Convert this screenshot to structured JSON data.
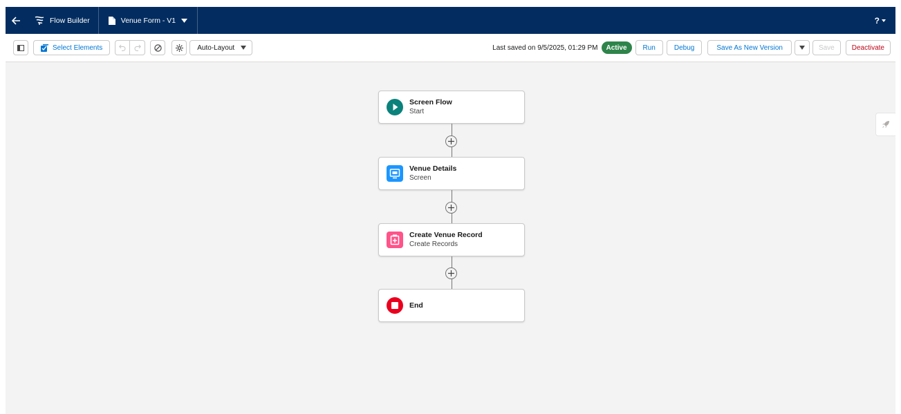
{
  "topbar": {
    "app_label": "Flow Builder",
    "flow_label": "Venue Form - V1",
    "help_label": "?"
  },
  "toolbar": {
    "select_elements_label": "Select Elements",
    "layout_label": "Auto-Layout",
    "last_saved": "Last saved on 9/5/2025, 01:29 PM",
    "status_badge": "Active",
    "run_label": "Run",
    "debug_label": "Debug",
    "save_as_new_version_label": "Save As New Version",
    "save_label": "Save",
    "deactivate_label": "Deactivate"
  },
  "flow": {
    "nodes": [
      {
        "title": "Screen Flow",
        "subtitle": "Start",
        "icon": "play-icon",
        "color": "#0b827c"
      },
      {
        "title": "Venue Details",
        "subtitle": "Screen",
        "icon": "screen-icon",
        "color": "#1b96ff"
      },
      {
        "title": "Create Venue Record",
        "subtitle": "Create Records",
        "icon": "record-create-icon",
        "color": "#ff538a"
      },
      {
        "title": "End",
        "subtitle": "",
        "icon": "stop-icon",
        "color": "#ea001e"
      }
    ]
  },
  "colors": {
    "topbar": "#032d60",
    "brand_blue": "#0176d3",
    "active_green": "#2e844a",
    "deactivate_red": "#ba0517",
    "canvas": "#f3f3f3"
  }
}
